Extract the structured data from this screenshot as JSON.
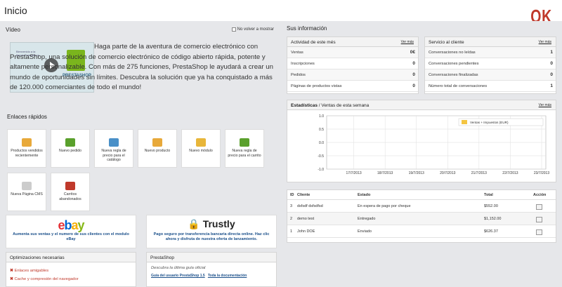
{
  "header": {
    "title": "Inicio",
    "ok_label": "OK"
  },
  "video": {
    "title": "Vídeo",
    "hide_label": "No volver a mostrar",
    "thumb_brand": "PRESTASHOP",
    "thumb_caption": "Bienvenido a la tienda PrestaShop",
    "text": "Haga parte de la aventura de comercio electrónico con PrestaShop, una solución de comercio electrónico de código abierto rápida, potente y altamente personalizable. Con más de 275 funciones, PrestaShop le ayudará a crear un mundo de oportunidades sin límites. Descubra la solución que ya ha conquistado a más de 120.000 comerciantes de todo el mundo!"
  },
  "quick_links": {
    "title": "Enlaces rápidos",
    "items": [
      {
        "label": "Productos vendidos recientemente"
      },
      {
        "label": "Nuevo pedido"
      },
      {
        "label": "Nueva regla de precio para el catálogo"
      },
      {
        "label": "Nuevo producto"
      },
      {
        "label": "Nuevo módulo"
      },
      {
        "label": "Nueva regla de precio para el carrito"
      },
      {
        "label": "Nueva Página CMS"
      },
      {
        "label": "Carritos abandonados"
      }
    ]
  },
  "ads": {
    "ebay_logo": "ebay",
    "ebay_text": "Aumenta sus ventas y el numero de sus clientes con el modulo eBay",
    "trustly_logo": "Trustly",
    "trustly_text": "Pago seguro por transferencia bancaria directa online. Haz clic ahora y disfruta de nuestra oferta de lanzamiento."
  },
  "optimizations": {
    "title": "Optimizaciones necesarias",
    "items": [
      "Enlaces amigables",
      "Cache y compresión del navegador"
    ]
  },
  "prestashop": {
    "title": "PrestaShop",
    "tagline": "Descubra la última guía oficial",
    "guide_link": "Guía del usuario PrestaShop 1.5",
    "docs_link": "Toda la documentación"
  },
  "info": {
    "title": "Sus información"
  },
  "activity": {
    "title": "Actividad de este més",
    "more": "Ver más",
    "rows": [
      {
        "label": "Ventas",
        "value": "0€"
      },
      {
        "label": "Inscripciones",
        "value": "0"
      },
      {
        "label": "Pedidos",
        "value": "0"
      },
      {
        "label": "Páginas de productos vistas",
        "value": "0"
      }
    ]
  },
  "service": {
    "title": "Servicio al cliente",
    "more": "Ver más",
    "rows": [
      {
        "label": "Conversaciones no leídas",
        "value": "1"
      },
      {
        "label": "Conversaciones pendientes",
        "value": "0"
      },
      {
        "label": "Conversaciones finalizadas",
        "value": "0"
      },
      {
        "label": "Número total de conversaciones",
        "value": "1"
      }
    ]
  },
  "stats": {
    "title_bold": "Estadísticas",
    "title_rest": " / Ventas de esta semana",
    "more": "Ver más"
  },
  "chart_data": {
    "type": "line",
    "x": [
      "17/7/2013",
      "18/7/2013",
      "19/7/2013",
      "20/7/2013",
      "21/7/2013",
      "22/7/2013",
      "23/7/2013"
    ],
    "series": [
      {
        "name": "Ventas + Impuestos (EUR)",
        "values": [
          0,
          0,
          0,
          0,
          0,
          0,
          0
        ],
        "color": "#f4c542"
      }
    ],
    "ylim": [
      -1.0,
      1.0
    ],
    "yticks": [
      "1.0",
      "0.5",
      "0.0",
      "-0.5",
      "-1.0"
    ],
    "legend": "top-right",
    "grid": true
  },
  "orders": {
    "headers": {
      "id": "ID",
      "client": "Cliente",
      "status": "Estado",
      "total": "Total",
      "action": "Acción"
    },
    "rows": [
      {
        "id": "3",
        "client": "dsfsdf dsfsdfsd",
        "status": "En espera de pago por cheque",
        "total": "$552.00"
      },
      {
        "id": "2",
        "client": "demo test",
        "status": "Entregado",
        "total": "$1,152.00"
      },
      {
        "id": "1",
        "client": "John DOE",
        "status": "Enviado",
        "total": "$626.37"
      }
    ]
  },
  "colors": {
    "ok": "#c0392b",
    "bg": "#e6e7ea",
    "link": "#1a4f8a"
  }
}
